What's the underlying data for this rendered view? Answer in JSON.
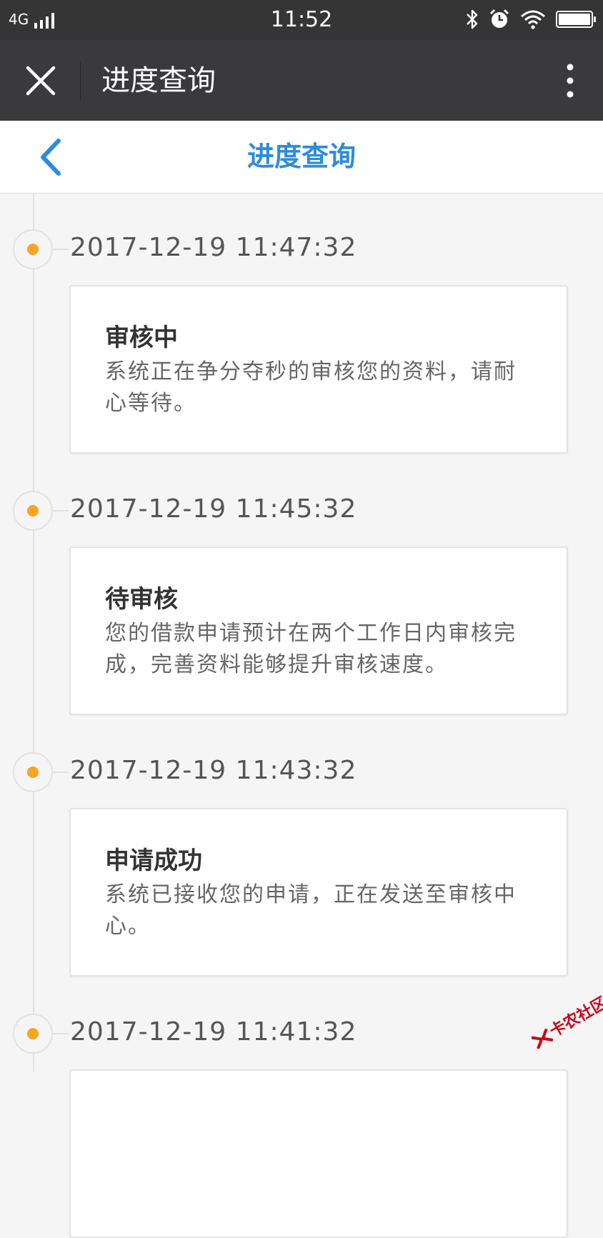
{
  "status_bar": {
    "network": "4G",
    "time": "11:52",
    "icons": [
      "signal-icon",
      "bluetooth-icon",
      "alarm-icon",
      "wifi-icon",
      "battery-icon"
    ]
  },
  "app_bar": {
    "title": "进度查询",
    "close_icon": "close-icon",
    "more_icon": "more-vertical-icon"
  },
  "page_header": {
    "title": "进度查询",
    "back_icon": "chevron-left-icon"
  },
  "colors": {
    "accent": "#2d8cdb",
    "timeline_dot": "#f5a623",
    "status_bar_bg": "#353535",
    "app_bar_bg": "#3a3a3c",
    "watermark": "#d0021b"
  },
  "timeline": [
    {
      "time": "2017-12-19 11:47:32",
      "title": "审核中",
      "description": "系统正在争分夺秒的审核您的资料，请耐心等待。"
    },
    {
      "time": "2017-12-19 11:45:32",
      "title": "待审核",
      "description": "您的借款申请预计在两个工作日内审核完成，完善资料能够提升审核速度。"
    },
    {
      "time": "2017-12-19 11:43:32",
      "title": "申请成功",
      "description": "系统已接收您的申请，正在发送至审核中心。"
    },
    {
      "time": "2017-12-19 11:41:32",
      "title": "",
      "description": ""
    }
  ],
  "watermark": {
    "text": "卡农社区"
  }
}
